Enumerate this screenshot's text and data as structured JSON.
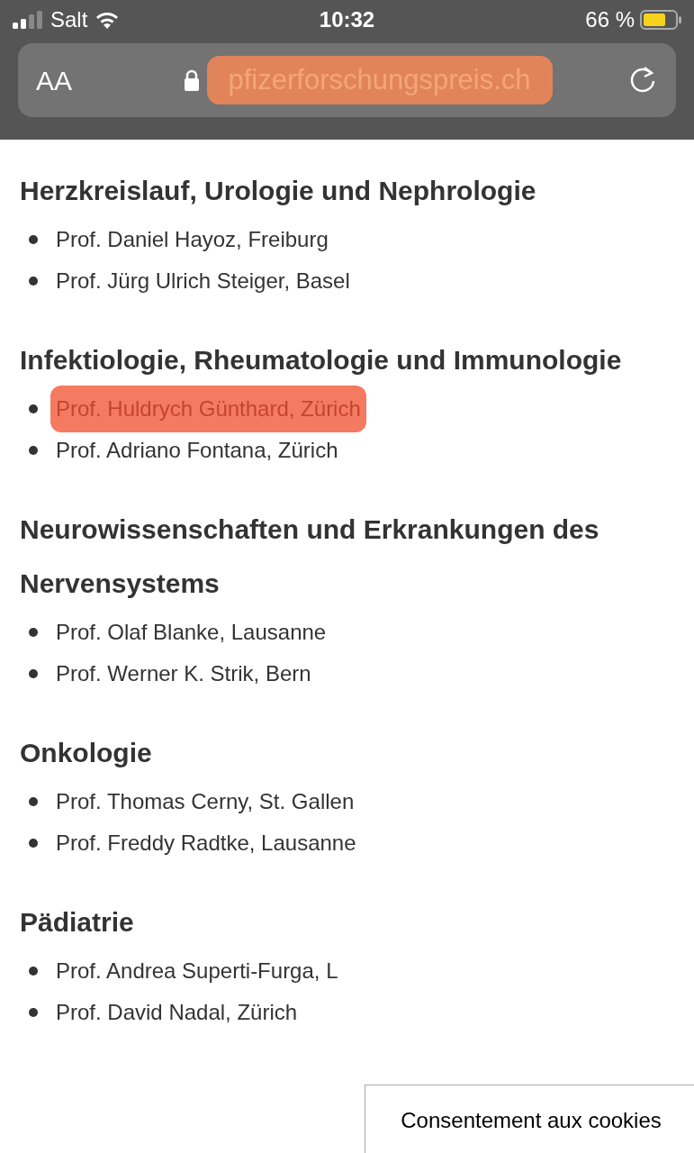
{
  "status_bar": {
    "carrier": "Salt",
    "time": "10:32",
    "battery": "66 %"
  },
  "address_bar": {
    "text_size_button": "AA",
    "url": "pfizerforschungspreis.ch",
    "highlighted": true
  },
  "sections": [
    {
      "heading": "Herzkreislauf, Urologie und Nephrologie",
      "items": [
        {
          "text": "Prof. Daniel Hayoz, Freiburg",
          "highlighted": false
        },
        {
          "text": "Prof. Jürg Ulrich Steiger, Basel",
          "highlighted": false
        }
      ]
    },
    {
      "heading": "Infektiologie, Rheumatologie und Immunologie",
      "items": [
        {
          "text": "Prof. Huldrych Günthard, Zürich",
          "highlighted": true
        },
        {
          "text": "Prof. Adriano Fontana, Zürich",
          "highlighted": false
        }
      ]
    },
    {
      "heading": "Neurowissenschaften und Erkrankungen des Nervensystems",
      "items": [
        {
          "text": "Prof. Olaf Blanke, Lausanne",
          "highlighted": false
        },
        {
          "text": "Prof. Werner K. Strik, Bern",
          "highlighted": false
        }
      ]
    },
    {
      "heading": "Onkologie",
      "items": [
        {
          "text": "Prof. Thomas Cerny, St. Gallen",
          "highlighted": false
        },
        {
          "text": "Prof. Freddy Radtke, Lausanne",
          "highlighted": false
        }
      ]
    },
    {
      "heading": "Pädiatrie",
      "items": [
        {
          "text": "Prof. Andrea Superti-Furga, L",
          "highlighted": false
        },
        {
          "text": "Prof. David Nadal, Zürich",
          "highlighted": false
        }
      ]
    }
  ],
  "cookie_banner": {
    "label": "Consentement aux cookies"
  }
}
